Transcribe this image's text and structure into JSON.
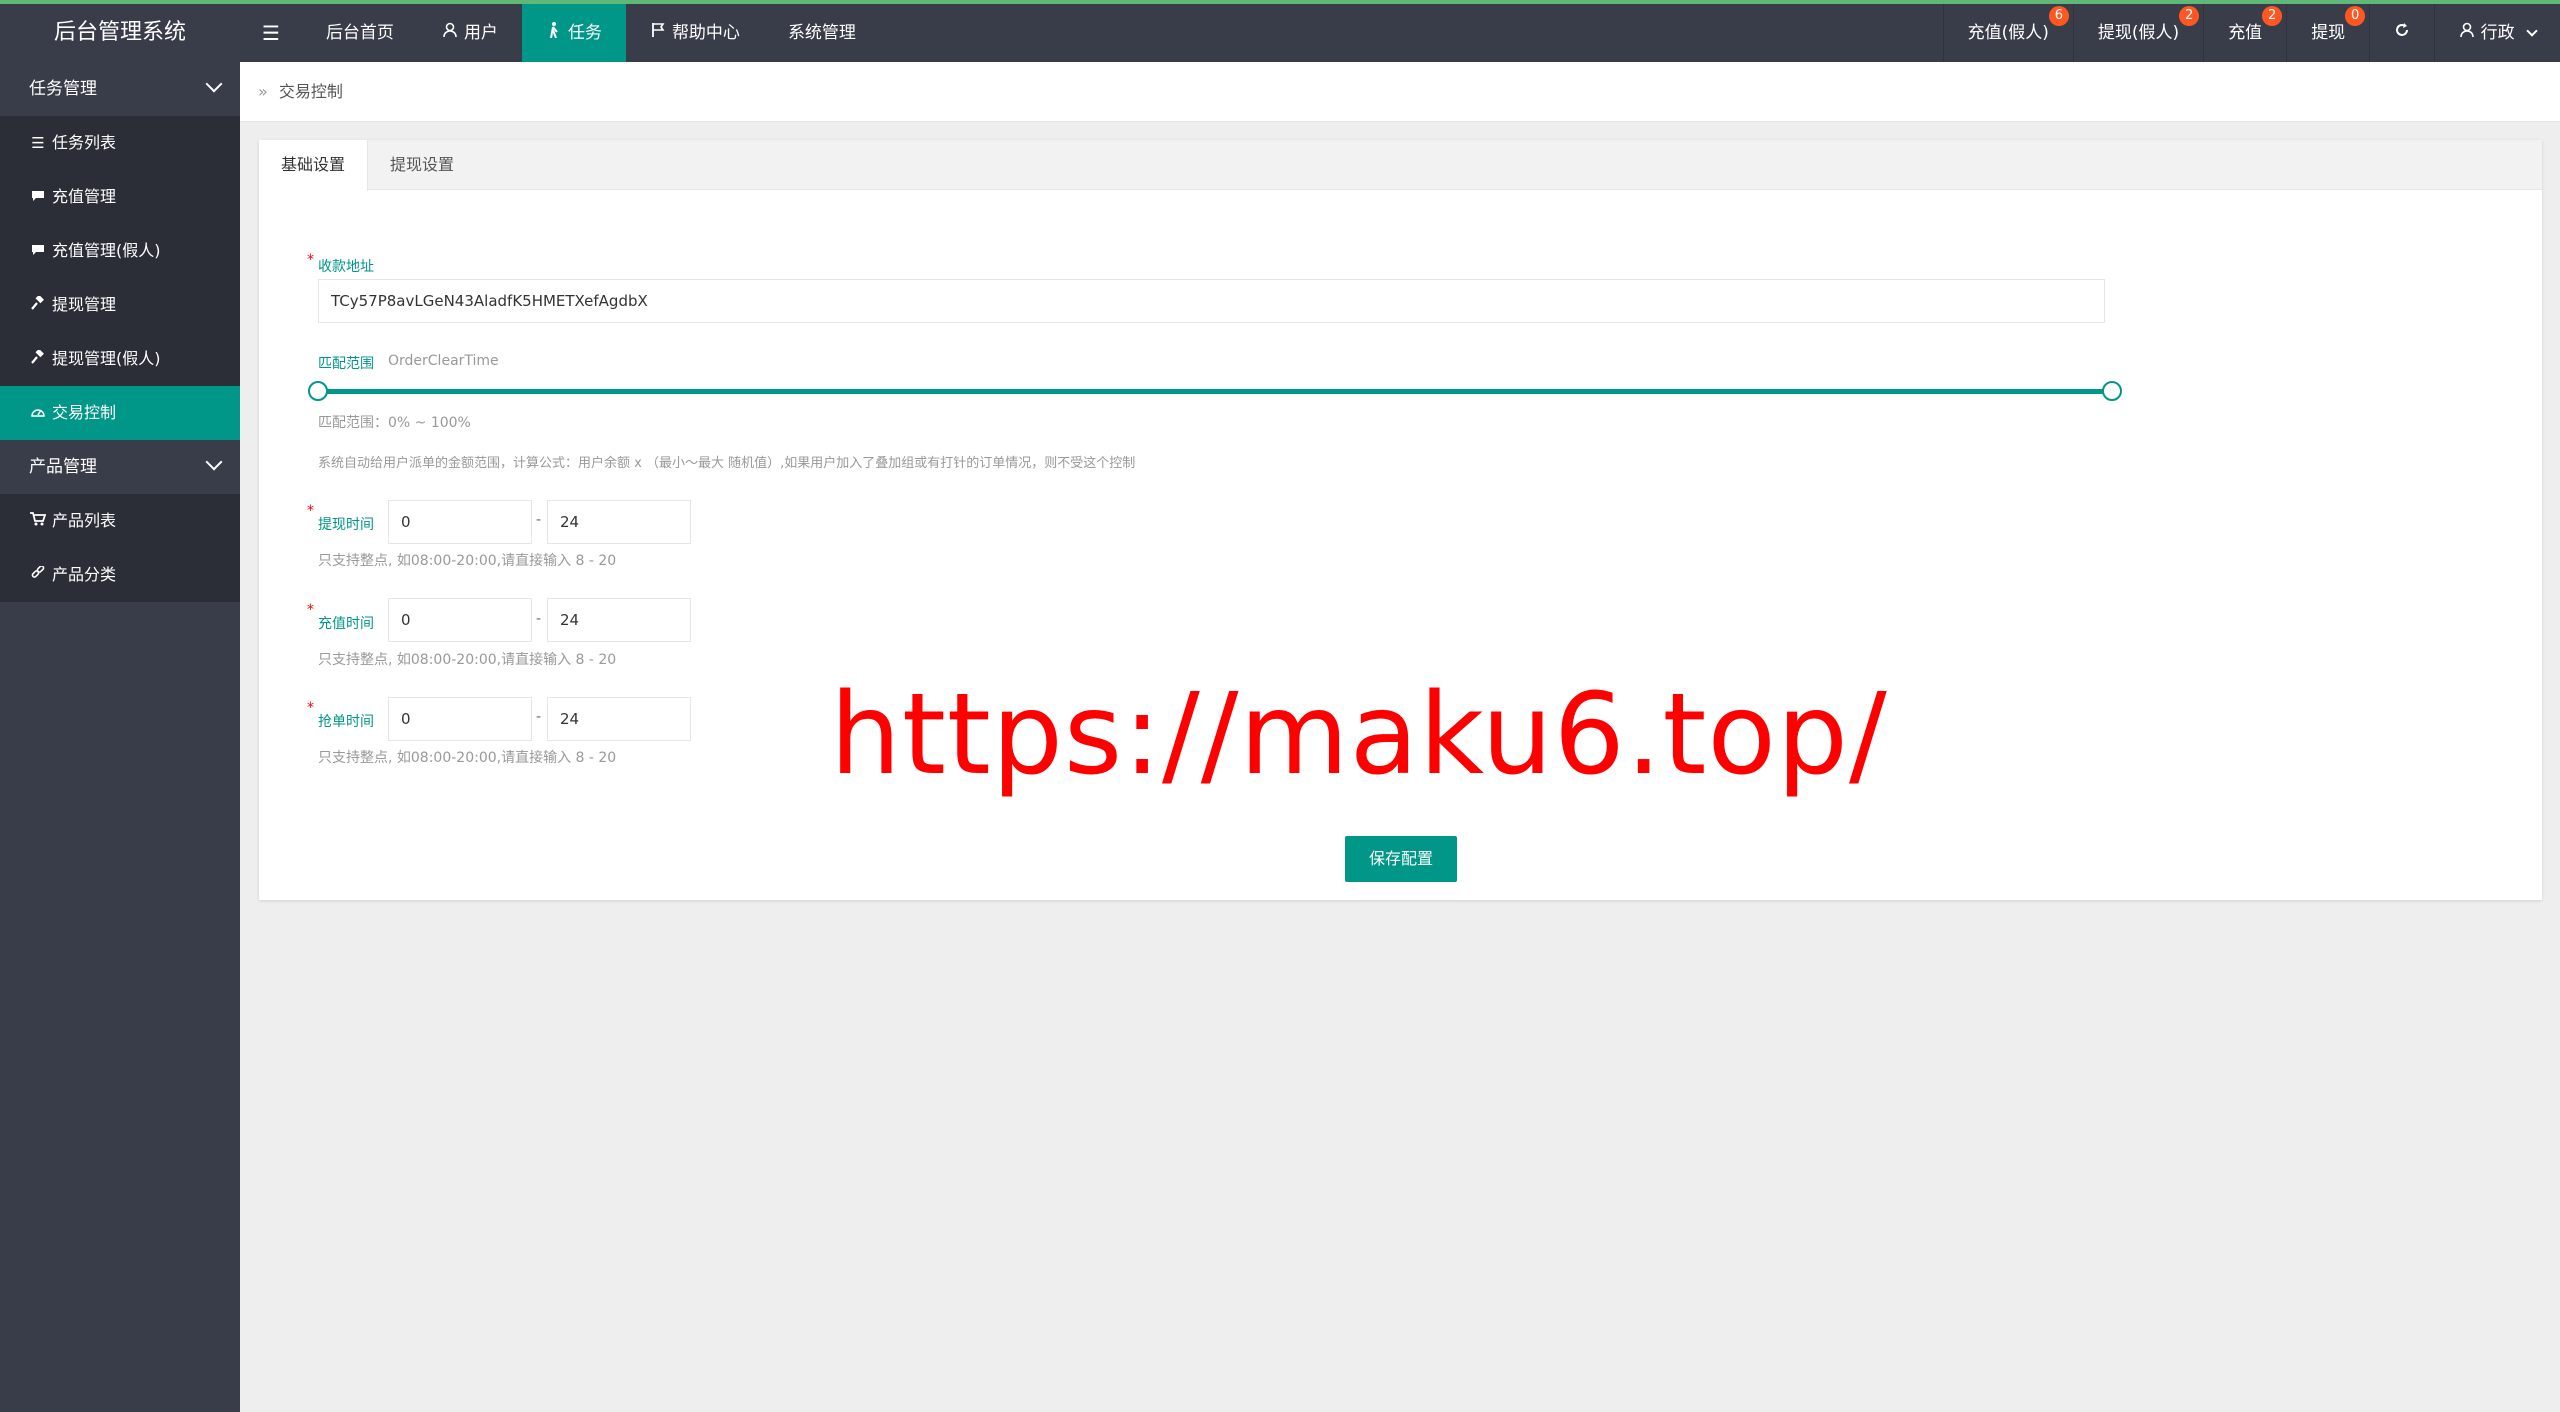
{
  "header": {
    "logo": "后台管理系统",
    "menu_toggle": "☰",
    "nav": [
      {
        "label": "后台首页",
        "icon": ""
      },
      {
        "label": "用户",
        "icon": "user-icon"
      },
      {
        "label": "任务",
        "icon": "walk-icon"
      },
      {
        "label": "帮助中心",
        "icon": "flag-icon"
      },
      {
        "label": "系统管理",
        "icon": ""
      }
    ],
    "right": [
      {
        "label": "充值(假人)",
        "badge": "6"
      },
      {
        "label": "提现(假人)",
        "badge": "2"
      },
      {
        "label": "充值",
        "badge": "2"
      },
      {
        "label": "提现",
        "badge": "0"
      }
    ],
    "user_label": "行政"
  },
  "sidebar": {
    "groups": [
      {
        "label": "任务管理",
        "items": [
          {
            "label": "任务列表",
            "icon": "list-icon"
          },
          {
            "label": "充值管理",
            "icon": "comment-icon"
          },
          {
            "label": "充值管理(假人)",
            "icon": "comment-icon"
          },
          {
            "label": "提现管理",
            "icon": "gavel-icon"
          },
          {
            "label": "提现管理(假人)",
            "icon": "gavel-icon"
          },
          {
            "label": "交易控制",
            "icon": "dashboard-icon",
            "active": true
          }
        ]
      },
      {
        "label": "产品管理",
        "items": [
          {
            "label": "产品列表",
            "icon": "cart-icon"
          },
          {
            "label": "产品分类",
            "icon": "link-icon"
          }
        ]
      }
    ]
  },
  "breadcrumb": {
    "separator": "»",
    "current": "交易控制"
  },
  "tabs": [
    "基础设置",
    "提现设置"
  ],
  "form": {
    "required_mark": "*",
    "address": {
      "label": "收款地址",
      "value": "TCy57P8avLGeN43AladfK5HMETXefAgdbX"
    },
    "match_range": {
      "label": "匹配范围",
      "field_name": "OrderClearTime",
      "low": 0,
      "high": 100,
      "range_text": "匹配范围：0% ~ 100%",
      "description": "系统自动给用户派单的金额范围，计算公式：用户余额 x （最小～最大 随机值）,如果用户加入了叠加组或有打针的订单情况，则不受这个控制"
    },
    "withdraw_time": {
      "label": "提现时间",
      "start": "0",
      "end": "24",
      "help": "只支持整点, 如08:00-20:00,请直接输入 8 - 20"
    },
    "recharge_time": {
      "label": "充值时间",
      "start": "0",
      "end": "24",
      "help": "只支持整点, 如08:00-20:00,请直接输入 8 - 20"
    },
    "grab_time": {
      "label": "抢单时间",
      "start": "0",
      "end": "24",
      "help": "只支持整点, 如08:00-20:00,请直接输入 8 - 20"
    },
    "dash": "-",
    "save_label": "保存配置"
  },
  "watermark": "https://maku6.top/"
}
